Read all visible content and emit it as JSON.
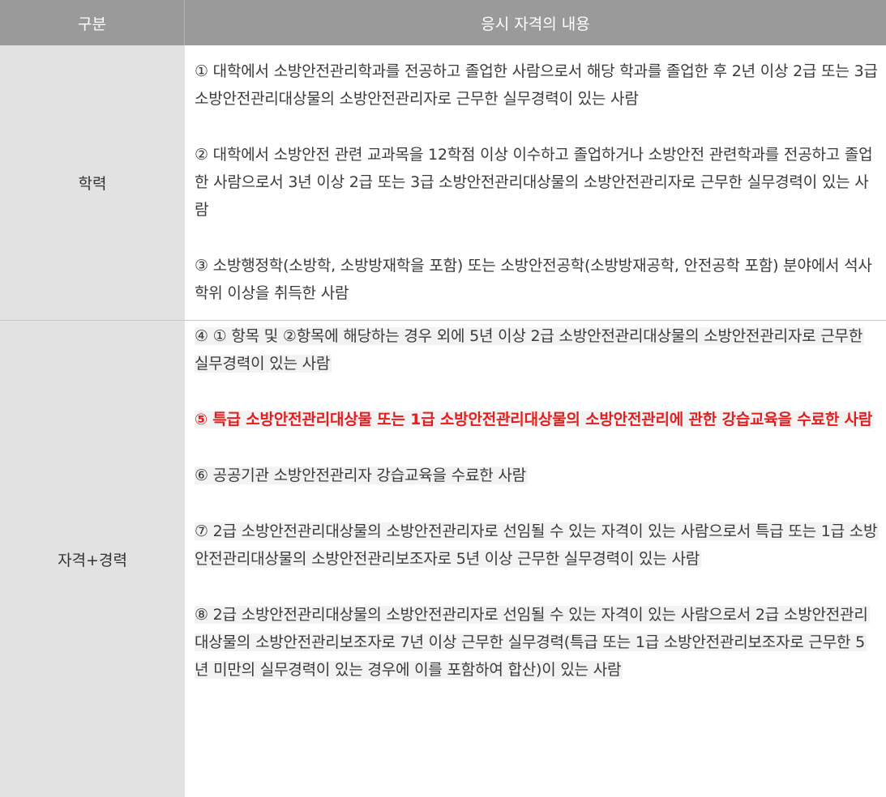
{
  "header": {
    "col1": "구분",
    "col2": "응시 자격의 내용"
  },
  "rows": [
    {
      "label": "학력",
      "items": [
        "① 대학에서 소방안전관리학과를 전공하고 졸업한 사람으로서 해당 학과를 졸업한 후 2년 이상 2급  또는 3급 소방안전관리대상물의 소방안전관리자로 근무한 실무경력이 있는 사람",
        "② 대학에서 소방안전 관련 교과목을 12학점 이상 이수하고 졸업하거나 소방안전 관련학과를 전공하고 졸업한 사람으로서 3년 이상 2급 또는 3급 소방안전관리대상물의 소방안전관리자로 근무한 실무경력이 있는 사람",
        "③ 소방행정학(소방학, 소방방재학을 포함) 또는 소방안전공학(소방방재공학, 안전공학 포함) 분야에서 석사학위 이상을 취득한 사람"
      ]
    },
    {
      "label": "자격+경력",
      "items": [
        "④ ① 항목 및 ②항목에 해당하는 경우 외에 5년 이상 2급 소방안전관리대상물의 소방안전관리자로 근무한 실무경력이 있는 사람",
        "⑤ 특급 소방안전관리대상물 또는 1급 소방안전관리대상물의 소방안전관리에 관한 강습교육을 수료한 사람",
        "⑥ 공공기관 소방안전관리자 강습교육을 수료한 사람",
        "⑦ 2급 소방안전관리대상물의 소방안전관리자로 선임될 수 있는 자격이 있는 사람으로서 특급 또는 1급 소방안전관리대상물의 소방안전관리보조자로 5년 이상 근무한 실무경력이 있는 사람",
        "⑧ 2급 소방안전관리대상물의 소방안전관리자로 선임될 수 있는 자격이 있는 사람으로서 2급 소방안전관리대상물의 소방안전관리보조자로 7년 이상 근무한 실무경력(특급 또는 1급 소방안전관리보조자로 근무한 5년 미만의 실무경력이 있는 경우에 이를 포함하여 합산)이 있는 사람"
      ]
    }
  ],
  "colors": {
    "header_bg": "#9a9a9a",
    "label_bg": "#e2e2e2",
    "highlight_text": "#e11f1f"
  }
}
